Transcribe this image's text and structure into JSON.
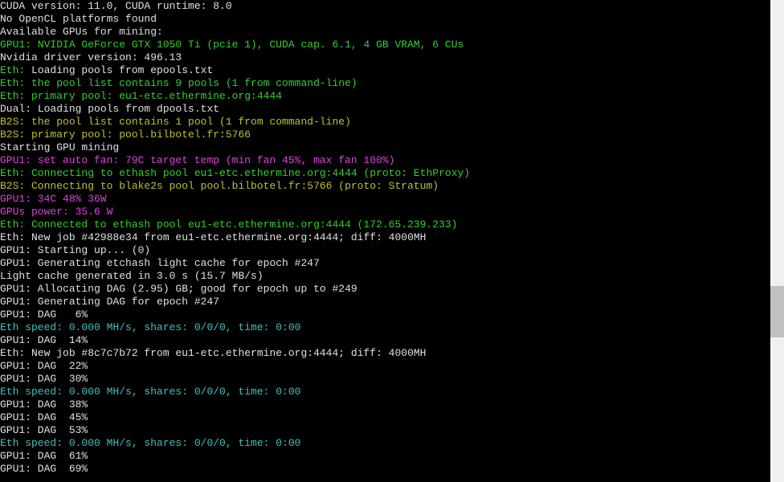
{
  "lines": [
    {
      "parts": [
        {
          "text": "CUDA version: 11.0, CUDA runtime: 8.0",
          "cls": "c-white"
        }
      ]
    },
    {
      "parts": [
        {
          "text": "No OpenCL platforms found",
          "cls": "c-white"
        }
      ]
    },
    {
      "parts": [
        {
          "text": "Available GPUs for mining:",
          "cls": "c-white"
        }
      ]
    },
    {
      "parts": [
        {
          "text": "GPU1: NVIDIA GeForce GTX 1050 Ti (pcie 1), CUDA cap. 6.1, 4 GB VRAM, 6 CUs",
          "cls": "c-green"
        }
      ]
    },
    {
      "parts": [
        {
          "text": "Nvidia driver version: 496.13",
          "cls": "c-white"
        }
      ]
    },
    {
      "parts": [
        {
          "text": "Eth: ",
          "cls": "c-green"
        },
        {
          "text": "Loading pools from epools.txt",
          "cls": "c-white"
        }
      ]
    },
    {
      "parts": [
        {
          "text": "Eth: the pool list contains 9 pools (1 from command-line)",
          "cls": "c-green"
        }
      ]
    },
    {
      "parts": [
        {
          "text": "Eth: primary pool: eu1-etc.ethermine.org:4444",
          "cls": "c-green"
        }
      ]
    },
    {
      "parts": [
        {
          "text": "Dual: ",
          "cls": "c-white"
        },
        {
          "text": "Loading pools from dpools.txt",
          "cls": "c-white"
        }
      ]
    },
    {
      "parts": [
        {
          "text": "B2S: the pool list contains 1 pool (1 from command-line)",
          "cls": "c-yellow"
        }
      ]
    },
    {
      "parts": [
        {
          "text": "B2S: primary pool: pool.bilbotel.fr:5766",
          "cls": "c-yellow"
        }
      ]
    },
    {
      "parts": [
        {
          "text": "Starting GPU mining",
          "cls": "c-white"
        }
      ]
    },
    {
      "parts": [
        {
          "text": "GPU1: set auto fan: 79C target temp (min fan 45%, max fan 100%)",
          "cls": "c-magenta"
        }
      ]
    },
    {
      "parts": [
        {
          "text": "Eth: Connecting to ethash pool eu1-etc.ethermine.org:4444 (proto: EthProxy)",
          "cls": "c-green"
        }
      ]
    },
    {
      "parts": [
        {
          "text": "B2S: Connecting to blake2s pool pool.bilbotel.fr:5766 (proto: Stratum)",
          "cls": "c-yellow"
        }
      ]
    },
    {
      "parts": [
        {
          "text": "GPU1: 34C 48% 36W",
          "cls": "c-magenta"
        }
      ]
    },
    {
      "parts": [
        {
          "text": "GPUs power: 35.6 W",
          "cls": "c-magenta"
        }
      ]
    },
    {
      "parts": [
        {
          "text": "Eth: Connected to ethash pool eu1-etc.ethermine.org:4444 (172.65.239.233)",
          "cls": "c-green"
        }
      ]
    },
    {
      "parts": [
        {
          "text": "Eth: New job #42988e34 from eu1-etc.ethermine.org:4444; diff: 4000MH",
          "cls": "c-white"
        }
      ]
    },
    {
      "parts": [
        {
          "text": "GPU1: Starting up... (0)",
          "cls": "c-white"
        }
      ]
    },
    {
      "parts": [
        {
          "text": "GPU1: Generating etchash light cache for epoch #247",
          "cls": "c-white"
        }
      ]
    },
    {
      "parts": [
        {
          "text": "Light cache generated in 3.0 s (15.7 MB/s)",
          "cls": "c-white"
        }
      ]
    },
    {
      "parts": [
        {
          "text": "GPU1: Allocating DAG (2.95) GB; good for epoch up to #249",
          "cls": "c-white"
        }
      ]
    },
    {
      "parts": [
        {
          "text": "GPU1: Generating DAG for epoch #247",
          "cls": "c-white"
        }
      ]
    },
    {
      "parts": [
        {
          "text": "GPU1: DAG   6%",
          "cls": "c-white"
        }
      ]
    },
    {
      "parts": [
        {
          "text": "Eth speed: 0.000 MH/s, shares: 0/0/0, time: 0:00",
          "cls": "c-cyan"
        }
      ]
    },
    {
      "parts": [
        {
          "text": "GPU1: DAG  14%",
          "cls": "c-white"
        }
      ]
    },
    {
      "parts": [
        {
          "text": "Eth: New job #8c7c7b72 from eu1-etc.ethermine.org:4444; diff: 4000MH",
          "cls": "c-white"
        }
      ]
    },
    {
      "parts": [
        {
          "text": "GPU1: DAG  22%",
          "cls": "c-white"
        }
      ]
    },
    {
      "parts": [
        {
          "text": "GPU1: DAG  30%",
          "cls": "c-white"
        }
      ]
    },
    {
      "parts": [
        {
          "text": "Eth speed: 0.000 MH/s, shares: 0/0/0, time: 0:00",
          "cls": "c-cyan"
        }
      ]
    },
    {
      "parts": [
        {
          "text": "GPU1: DAG  38%",
          "cls": "c-white"
        }
      ]
    },
    {
      "parts": [
        {
          "text": "GPU1: DAG  45%",
          "cls": "c-white"
        }
      ]
    },
    {
      "parts": [
        {
          "text": "GPU1: DAG  53%",
          "cls": "c-white"
        }
      ]
    },
    {
      "parts": [
        {
          "text": "Eth speed: 0.000 MH/s, shares: 0/0/0, time: 0:00",
          "cls": "c-cyan"
        }
      ]
    },
    {
      "parts": [
        {
          "text": "GPU1: DAG  61%",
          "cls": "c-white"
        }
      ]
    },
    {
      "parts": [
        {
          "text": "GPU1: DAG  69%",
          "cls": "c-white"
        }
      ]
    }
  ]
}
